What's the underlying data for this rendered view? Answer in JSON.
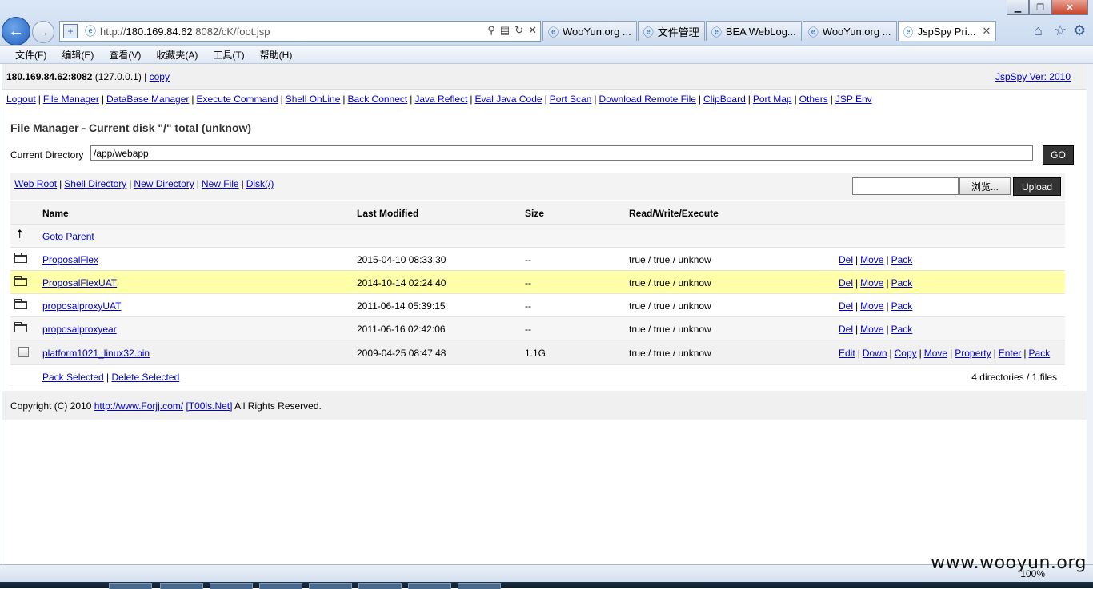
{
  "browser": {
    "url_prefix": "http://",
    "url_host": "180.169.84.62",
    "url_path": ":8082/cK/foot.jsp",
    "tabs": [
      {
        "label": "WooYun.org ..."
      },
      {
        "label": "文件管理"
      },
      {
        "label": "BEA WebLog..."
      },
      {
        "label": "WooYun.org ..."
      },
      {
        "label": "JspSpy Pri..."
      }
    ],
    "menu": [
      "文件(F)",
      "编辑(E)",
      "查看(V)",
      "收藏夹(A)",
      "工具(T)",
      "帮助(H)"
    ],
    "zoom": "100%"
  },
  "topbar": {
    "host": "180.169.84.62:8082",
    "local": "(127.0.0.1) |",
    "copy": "copy",
    "version": "JspSpy Ver: 2010"
  },
  "nav": [
    "Logout",
    "File Manager",
    "DataBase Manager",
    "Execute Command",
    "Shell OnLine",
    "Back Connect",
    "Java Reflect",
    "Eval Java Code",
    "Port Scan",
    "Download Remote File",
    "ClipBoard",
    "Port Map",
    "Others",
    "JSP Env"
  ],
  "file_manager": {
    "title": "File Manager - Current disk \"/\" total (unknow)",
    "current_dir_label": "Current Directory",
    "current_dir": "/app/webapp",
    "go": "GO",
    "links": [
      "Web Root",
      "Shell Directory",
      "New Directory",
      "New File",
      "Disk(/)"
    ],
    "browse": "浏览...",
    "upload": "Upload",
    "headers": {
      "name": "Name",
      "modified": "Last Modified",
      "size": "Size",
      "rwx": "Read/Write/Execute"
    },
    "goto_parent": "Goto Parent",
    "rows": [
      {
        "name": "ProposalFlex",
        "modified": "2015-04-10 08:33:30",
        "size": "--",
        "rwx": "true / true / unknow",
        "actions": [
          "Del",
          "Move",
          "Pack"
        ]
      },
      {
        "name": "ProposalFlexUAT",
        "modified": "2014-10-14 02:24:40",
        "size": "--",
        "rwx": "true / true / unknow",
        "actions": [
          "Del",
          "Move",
          "Pack"
        ]
      },
      {
        "name": "proposalproxyUAT",
        "modified": "2011-06-14 05:39:15",
        "size": "--",
        "rwx": "true / true / unknow",
        "actions": [
          "Del",
          "Move",
          "Pack"
        ]
      },
      {
        "name": "proposalproxyear",
        "modified": "2011-06-16 02:42:06",
        "size": "--",
        "rwx": "true / true / unknow",
        "actions": [
          "Del",
          "Move",
          "Pack"
        ]
      }
    ],
    "file": {
      "name": "platform1021_linux32.bin",
      "modified": "2009-04-25 08:47:48",
      "size": "1.1G",
      "rwx": "true / true / unknow",
      "actions": [
        "Edit",
        "Down",
        "Copy",
        "Move",
        "Property",
        "Enter",
        "Pack"
      ]
    },
    "pack_selected": "Pack Selected",
    "delete_selected": "Delete Selected",
    "summary": "4 directories / 1 files"
  },
  "footer": {
    "prefix": "Copyright (C) 2010",
    "link1": "http://www.Forjj.com/",
    "link2": "[T00ls.Net]",
    "suffix": "All Rights Reserved."
  },
  "watermark": "www.wooyun.org"
}
